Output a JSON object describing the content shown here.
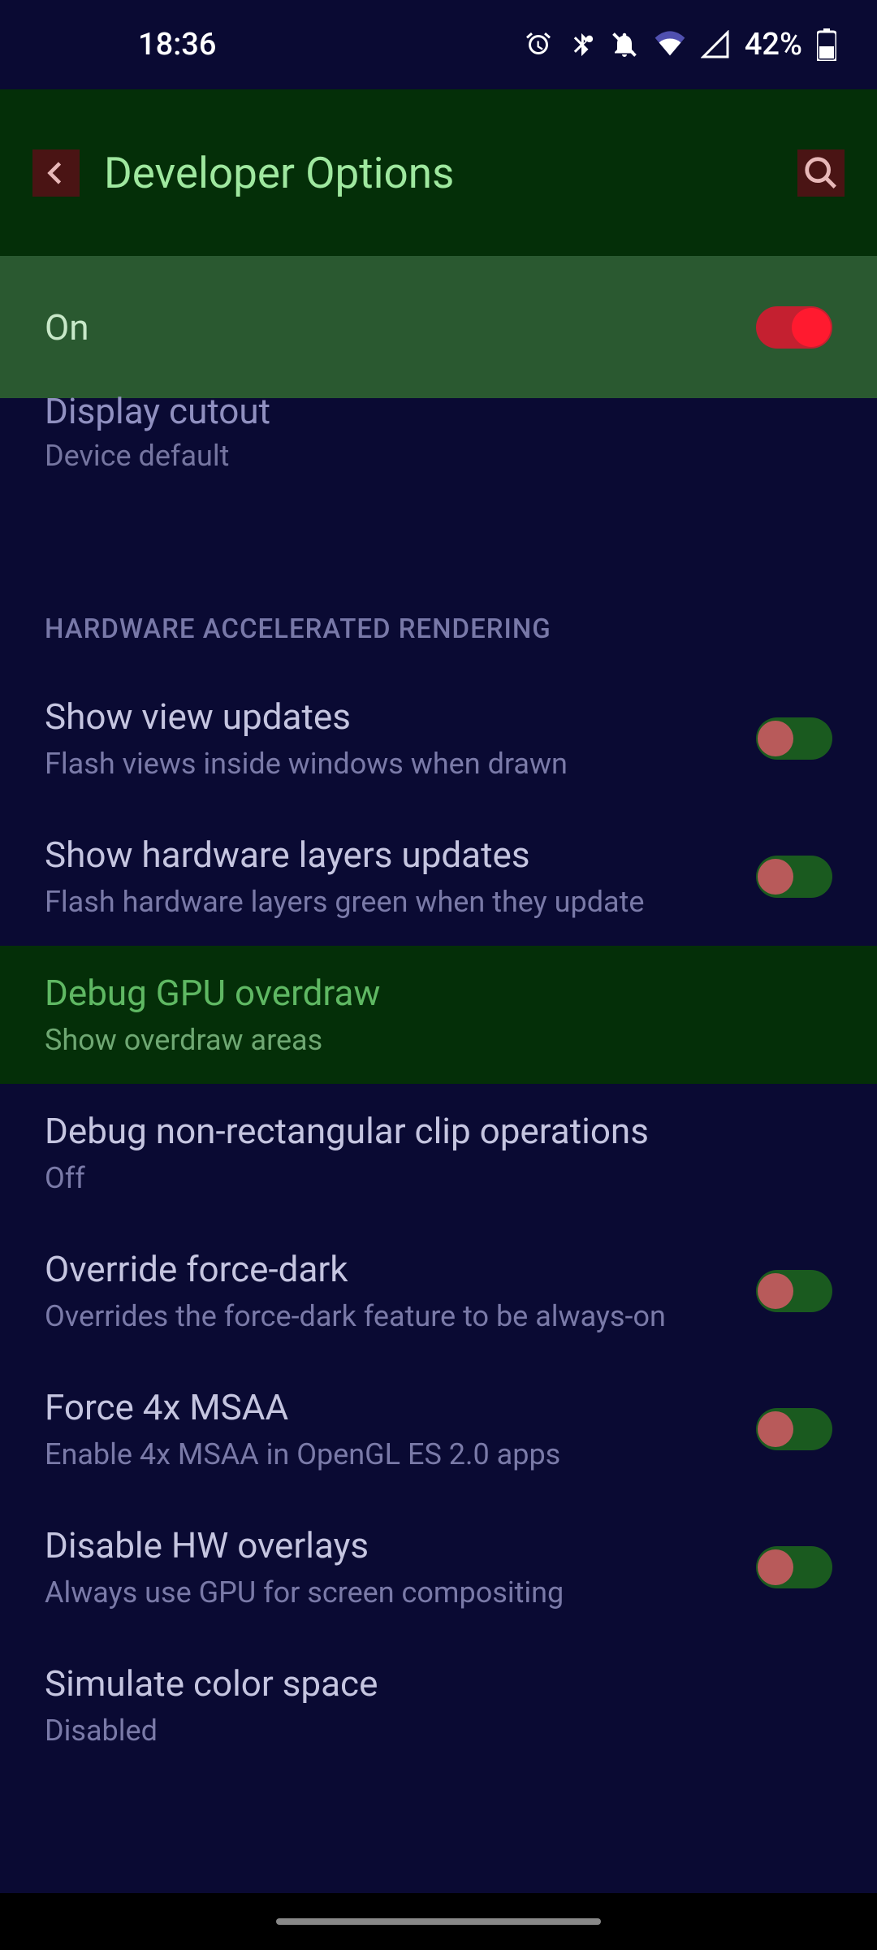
{
  "status": {
    "time": "18:36",
    "battery": "42%"
  },
  "appBar": {
    "title": "Developer Options"
  },
  "masterToggle": {
    "label": "On",
    "on": true
  },
  "cutItem": {
    "title": "Display cutout",
    "sub": "Device default"
  },
  "sectionHeader": "HARDWARE ACCELERATED RENDERING",
  "settings": [
    {
      "title": "Show view updates",
      "sub": "Flash views inside windows when drawn",
      "toggle": true,
      "on": true
    },
    {
      "title": "Show hardware layers updates",
      "sub": "Flash hardware layers green when they update",
      "toggle": true,
      "on": true
    },
    {
      "title": "Debug GPU overdraw",
      "sub": "Show overdraw areas",
      "toggle": false,
      "highlighted": true
    },
    {
      "title": "Debug non-rectangular clip operations",
      "sub": "Off",
      "toggle": false
    },
    {
      "title": "Override force-dark",
      "sub": "Overrides the force-dark feature to be always-on",
      "toggle": true,
      "on": true
    },
    {
      "title": "Force 4x MSAA",
      "sub": "Enable 4x MSAA in OpenGL ES 2.0 apps",
      "toggle": true,
      "on": true
    },
    {
      "title": "Disable HW overlays",
      "sub": "Always use GPU for screen compositing",
      "toggle": true,
      "on": true
    },
    {
      "title": "Simulate color space",
      "sub": "Disabled",
      "toggle": false
    }
  ]
}
